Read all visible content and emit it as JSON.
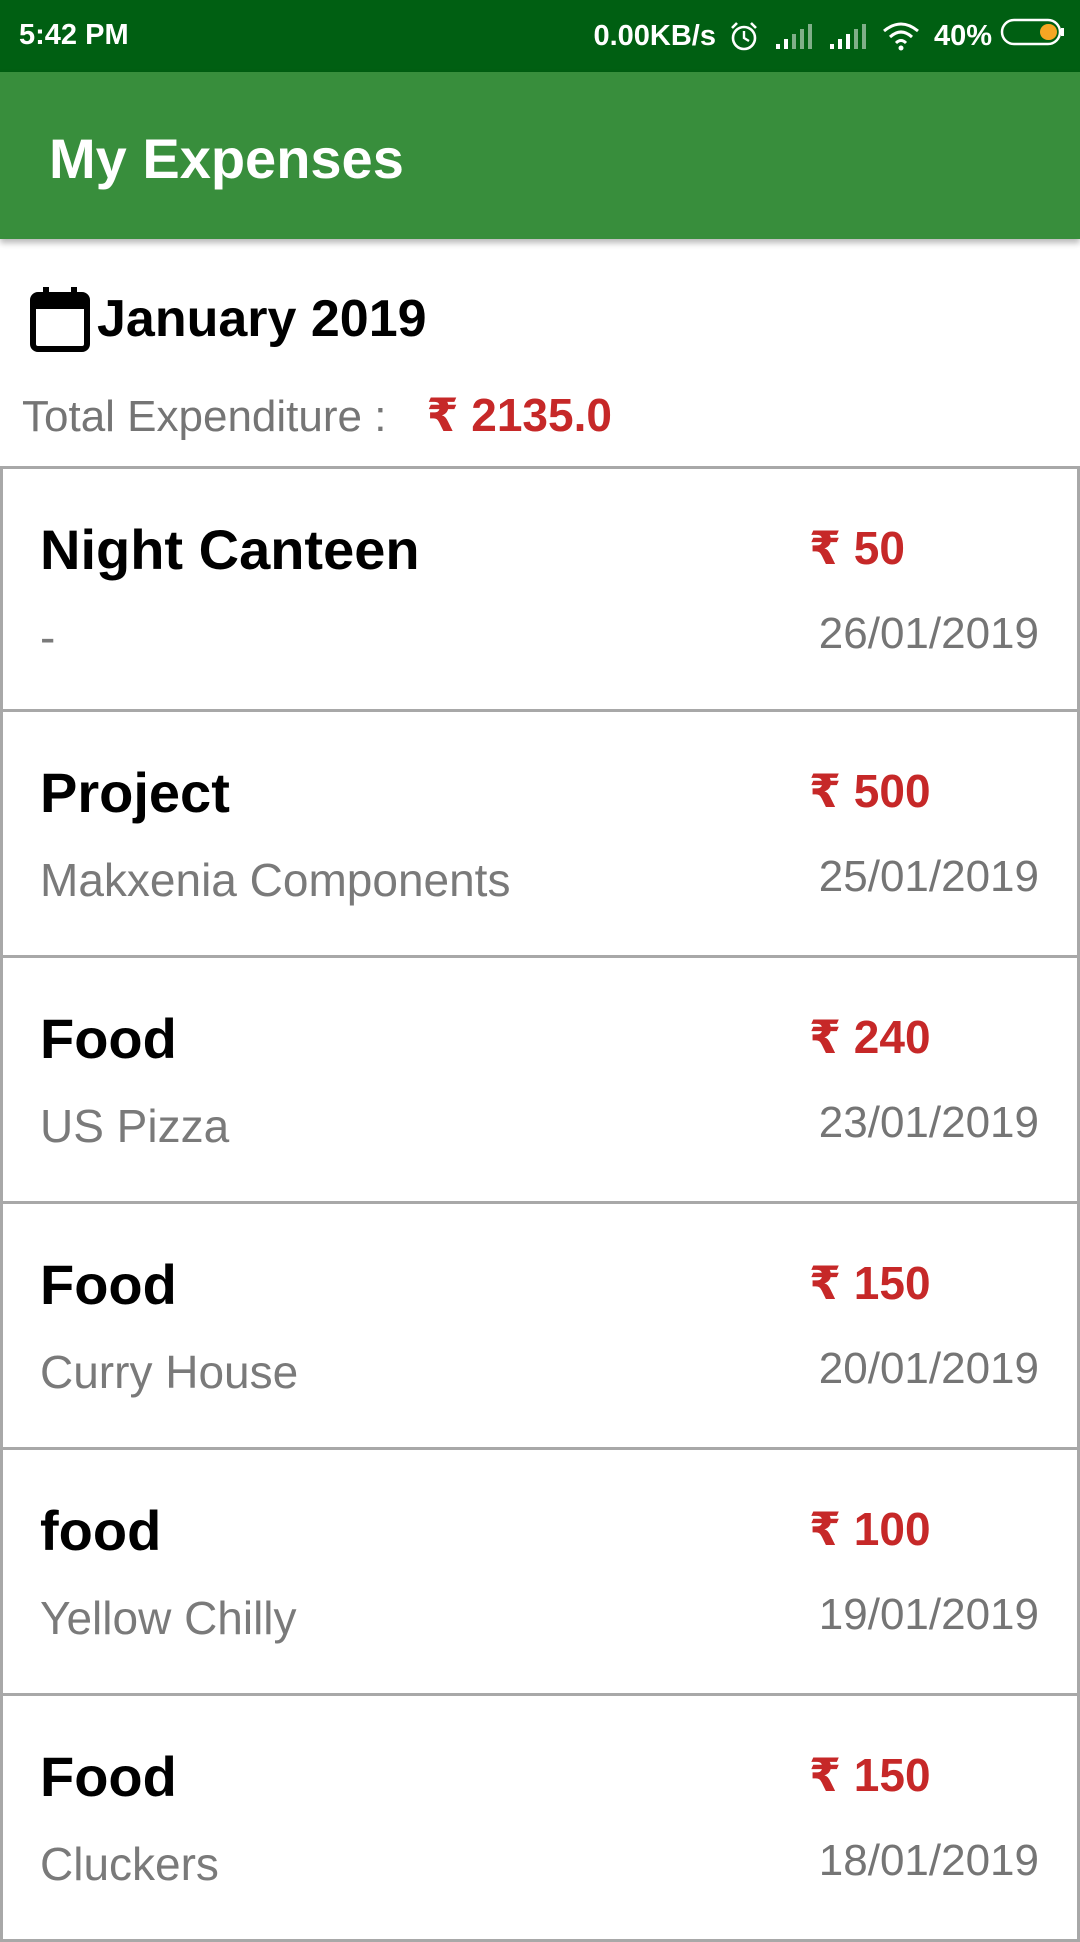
{
  "status_bar": {
    "time": "5:42 PM",
    "net_speed": "0.00KB/s",
    "battery": "40%",
    "icons": [
      "alarm-icon",
      "signal-icon",
      "signal-icon",
      "wifi-icon",
      "battery-icon"
    ],
    "battery_level": 0.4,
    "battery_color": "#f5a623"
  },
  "app_bar": {
    "title": "My Expenses",
    "color": "#388e3c"
  },
  "summary": {
    "month": "January 2019",
    "total_label": "Total Expenditure :",
    "total_amount": "₹ 2135.0",
    "amount_color": "#c62828"
  },
  "expenses": [
    {
      "category": "Night Canteen",
      "description": "-",
      "amount": "₹ 50",
      "date": "26/01/2019"
    },
    {
      "category": "Project",
      "description": "Makxenia Components",
      "amount": "₹ 500",
      "date": "25/01/2019"
    },
    {
      "category": "Food",
      "description": "US Pizza",
      "amount": "₹ 240",
      "date": "23/01/2019"
    },
    {
      "category": "Food",
      "description": "Curry House",
      "amount": "₹ 150",
      "date": "20/01/2019"
    },
    {
      "category": "food",
      "description": "Yellow Chilly",
      "amount": "₹ 100",
      "date": "19/01/2019"
    },
    {
      "category": "Food",
      "description": "Cluckers",
      "amount": "₹ 150",
      "date": "18/01/2019"
    }
  ]
}
